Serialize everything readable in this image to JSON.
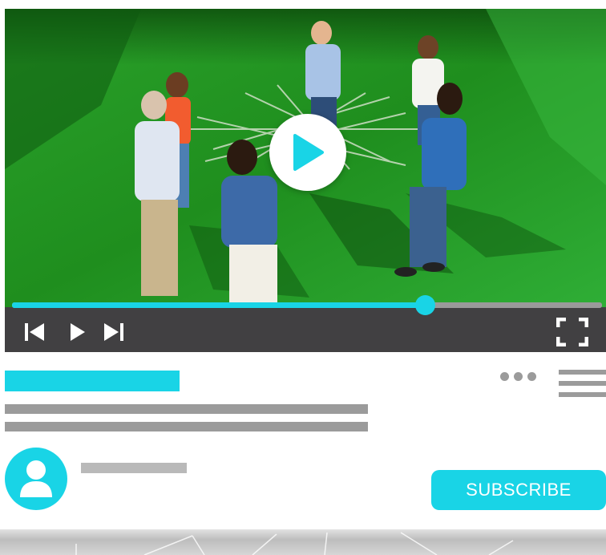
{
  "player": {
    "progress_fraction": 0.7,
    "controls": {
      "previous_icon": "skip-previous-icon",
      "play_icon": "play-icon",
      "next_icon": "skip-next-icon",
      "fullscreen_icon": "fullscreen-icon"
    },
    "center_play_icon": "play-icon"
  },
  "actions": {
    "more_icon": "more-horizontal-icon",
    "menu_icon": "hamburger-menu-icon"
  },
  "channel": {
    "avatar_icon": "user-icon"
  },
  "subscribe": {
    "label": "SUBSCRIBE"
  },
  "colors": {
    "accent": "#19d4e6",
    "control_bar": "#414042",
    "placeholder_gray": "#9b9b9b",
    "track_gray": "#9a9a9a"
  }
}
